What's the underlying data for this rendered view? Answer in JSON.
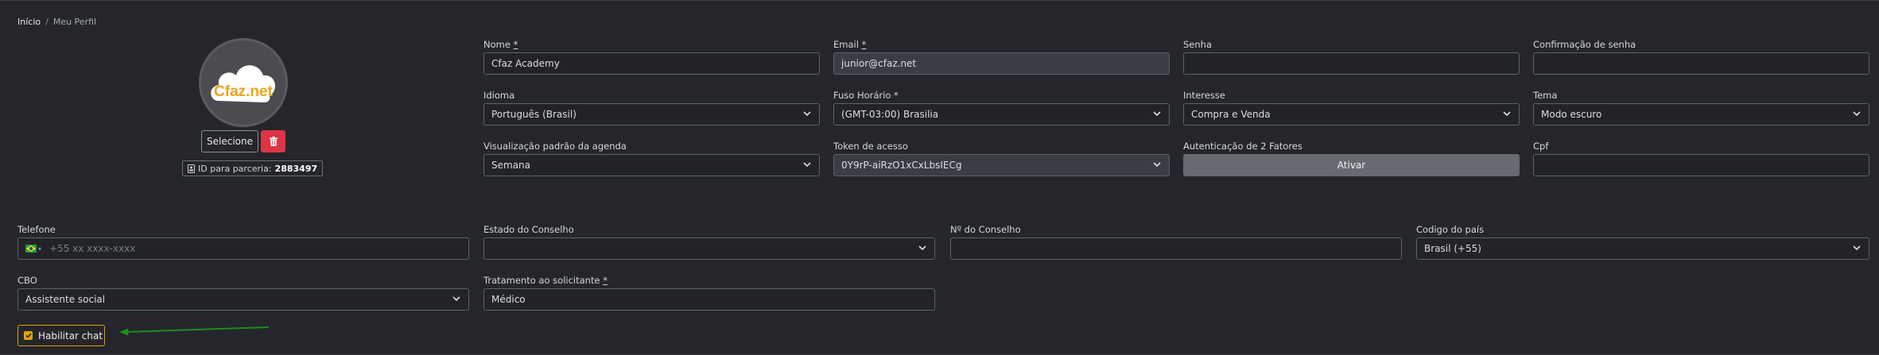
{
  "breadcrumb": {
    "home": "Início",
    "separator": "/",
    "current": "Meu Perfil"
  },
  "avatar": {
    "logo_text": "Cfaz.net",
    "select_label": "Selecione",
    "partner_prefix": "ID para parceria:",
    "partner_id": "2883497"
  },
  "fields": {
    "nome": {
      "label": "Nome",
      "required": "*",
      "value": "Cfaz Academy"
    },
    "email": {
      "label": "Email",
      "required": "*",
      "value": "junior@cfaz.net"
    },
    "senha": {
      "label": "Senha",
      "value": ""
    },
    "confirmacao": {
      "label": "Confirmação de senha",
      "value": ""
    },
    "idioma": {
      "label": "Idioma",
      "value": "Português (Brasil)"
    },
    "fuso": {
      "label": "Fuso Horário",
      "required": "*",
      "value": "(GMT-03:00) Brasilia"
    },
    "interesse": {
      "label": "Interesse",
      "value": "Compra e Venda"
    },
    "tema": {
      "label": "Tema",
      "value": "Modo escuro"
    },
    "visualizacao": {
      "label": "Visualização padrão da agenda",
      "value": "Semana"
    },
    "token": {
      "label": "Token de acesso",
      "value": "0Y9rP-aiRzO1xCxLbsIECg"
    },
    "dois_fatores": {
      "label": "Autenticação de 2 Fatores",
      "button": "Ativar"
    },
    "cpf": {
      "label": "Cpf",
      "value": ""
    },
    "telefone": {
      "label": "Telefone",
      "placeholder": "+55 xx xxxx-xxxx",
      "flag_caret": "▾"
    },
    "estado_conselho": {
      "label": "Estado do Conselho",
      "value": ""
    },
    "num_conselho": {
      "label": "Nº do Conselho",
      "value": ""
    },
    "codigo_pais": {
      "label": "Codigo do país",
      "value": "Brasil (+55)"
    },
    "cbo": {
      "label": "CBO",
      "value": "Assistente social"
    },
    "tratamento": {
      "label": "Tratamento ao solicitante",
      "required": "*",
      "value": "Médico"
    }
  },
  "chat": {
    "label": "Habilitar chat",
    "checked": true
  },
  "colors": {
    "background": "#24262b",
    "accent": "#e3a008",
    "danger": "#dc3545",
    "arrow": "#1e8c1e",
    "logo_orange": "#f0a21a"
  },
  "icons": [
    "cloud-logo-icon",
    "trash-icon",
    "id-card-icon",
    "chevron-down-icon",
    "brazil-flag-icon",
    "check-icon",
    "arrow-left-icon"
  ]
}
